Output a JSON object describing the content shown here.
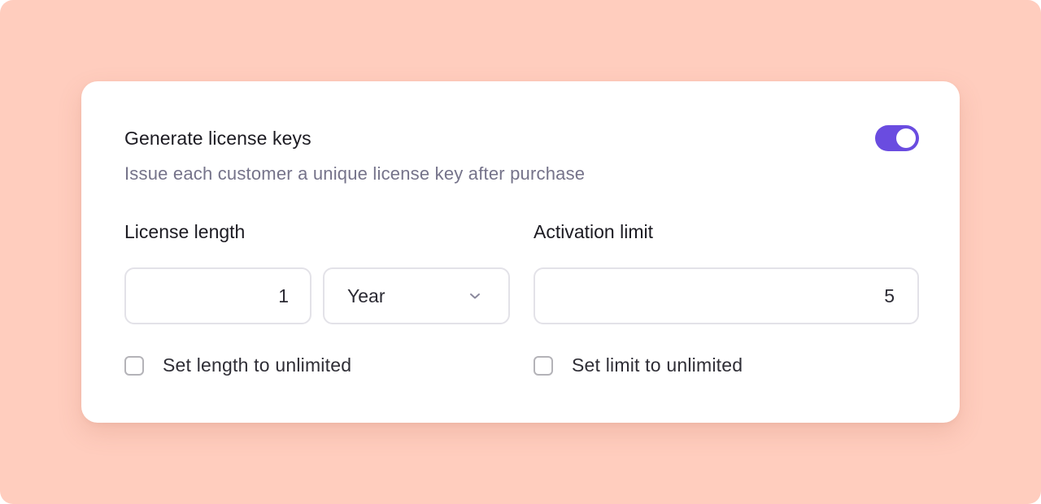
{
  "settings": {
    "title": "Generate license keys",
    "description": "Issue each customer a unique license key after purchase",
    "toggle_on": true,
    "accent_color": "#6a4ce0"
  },
  "license_length": {
    "label": "License length",
    "value": "1",
    "unit": "Year",
    "unlimited_label": "Set length to unlimited",
    "unlimited_checked": false
  },
  "activation_limit": {
    "label": "Activation limit",
    "value": "5",
    "unlimited_label": "Set limit to unlimited",
    "unlimited_checked": false
  },
  "icons": {
    "dropdown": "chevron-down-icon"
  }
}
